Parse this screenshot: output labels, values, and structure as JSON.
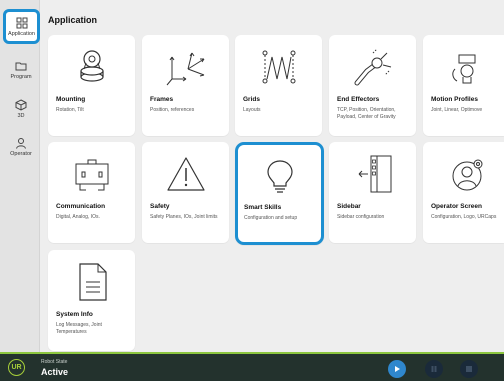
{
  "sidebar": {
    "items": [
      {
        "label": "Application",
        "icon": "grid-icon"
      },
      {
        "label": "Program",
        "icon": "folder-icon"
      },
      {
        "label": "3D",
        "icon": "cube-icon"
      },
      {
        "label": "Operator",
        "icon": "person-icon"
      }
    ]
  },
  "page": {
    "title": "Application"
  },
  "cards": [
    {
      "title": "Mounting",
      "desc": "Rotation, Tilt",
      "icon": "robot-base-icon"
    },
    {
      "title": "Frames",
      "desc": "Position, references",
      "icon": "frames-axes-icon"
    },
    {
      "title": "Grids",
      "desc": "Layouts",
      "icon": "grid-pattern-icon"
    },
    {
      "title": "End Effectors",
      "desc": "TCP, Position, Orientation, Payload, Center of Gravity",
      "icon": "end-effector-icon"
    },
    {
      "title": "Motion Profiles",
      "desc": "Joint, Linear, Optimove",
      "icon": "motion-profile-icon"
    },
    {
      "title": "Communication",
      "desc": "Digital, Analog, IOs.",
      "icon": "io-box-icon"
    },
    {
      "title": "Safety",
      "desc": "Safety Planes, IOs, Joint limits",
      "icon": "warning-icon"
    },
    {
      "title": "Smart Skills",
      "desc": "Configuration and setup",
      "icon": "lightbulb-icon"
    },
    {
      "title": "Sidebar",
      "desc": "Sidebar configuration",
      "icon": "sidebar-icon"
    },
    {
      "title": "Operator Screen",
      "desc": "Configuration, Logo, URCaps",
      "icon": "operator-screen-icon"
    },
    {
      "title": "System Info",
      "desc": "Log Messages, Joint Temperatures",
      "icon": "document-icon"
    }
  ],
  "status": {
    "label": "Robot State",
    "value": "Active",
    "logo": "UR"
  },
  "colors": {
    "accent": "#1d8fd1",
    "bar": "#23322d",
    "bar_accent": "#8cc63f",
    "play": "#2f87cd"
  }
}
